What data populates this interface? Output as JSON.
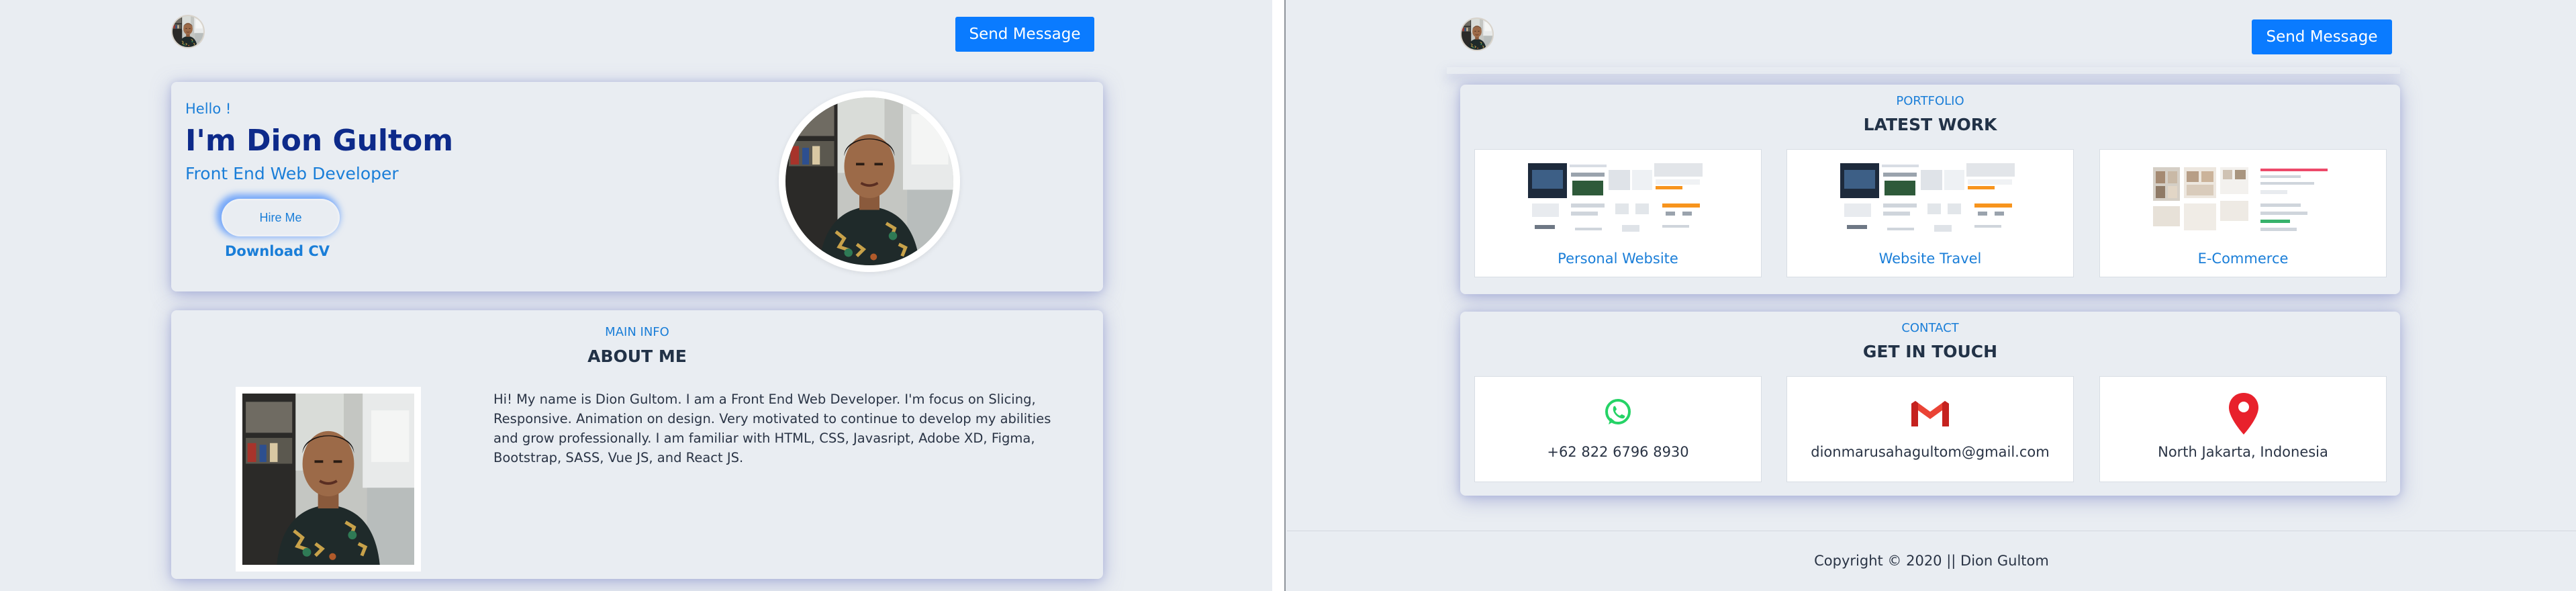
{
  "left": {
    "send_message_label": "Send Message",
    "hero": {
      "greeting": "Hello !",
      "name": "I'm Dion Gultom",
      "role": "Front End Web Developer",
      "hire_label": "Hire Me",
      "download_label": "Download CV"
    },
    "about": {
      "eyebrow": "MAIN INFO",
      "title": "ABOUT ME",
      "body": "Hi! My name is Dion Gultom. I am a Front End Web Developer. I'm focus on Slicing, Responsive. Animation on design. Very motivated to continue to develop my abilities and grow professionally. I am familiar with HTML, CSS, Javasript, Adobe XD, Figma, Bootstrap, SASS, Vue JS, and React JS."
    }
  },
  "right": {
    "send_message_label": "Send Message",
    "portfolio": {
      "eyebrow": "PORTFOLIO",
      "title": "LATEST WORK",
      "items": [
        {
          "label": "Personal Website"
        },
        {
          "label": "Website Travel"
        },
        {
          "label": "E-Commerce"
        }
      ]
    },
    "contact": {
      "eyebrow": "CONTACT",
      "title": "GET IN TOUCH",
      "items": [
        {
          "icon": "whatsapp-icon",
          "text": "+62 822 6796 8930"
        },
        {
          "icon": "gmail-icon",
          "text": "dionmarusahagultom@gmail.com"
        },
        {
          "icon": "map-pin-icon",
          "text": "North Jakarta, Indonesia"
        }
      ]
    },
    "footer": {
      "copyright": "Copyright © 2020 || Dion Gultom"
    }
  },
  "colors": {
    "accent": "#0a7bff",
    "heading_blue": "#0d2a8a",
    "link_blue": "#1a7ed8",
    "background": "#e9edf2",
    "whatsapp": "#25d366",
    "pin": "#e8212c"
  }
}
